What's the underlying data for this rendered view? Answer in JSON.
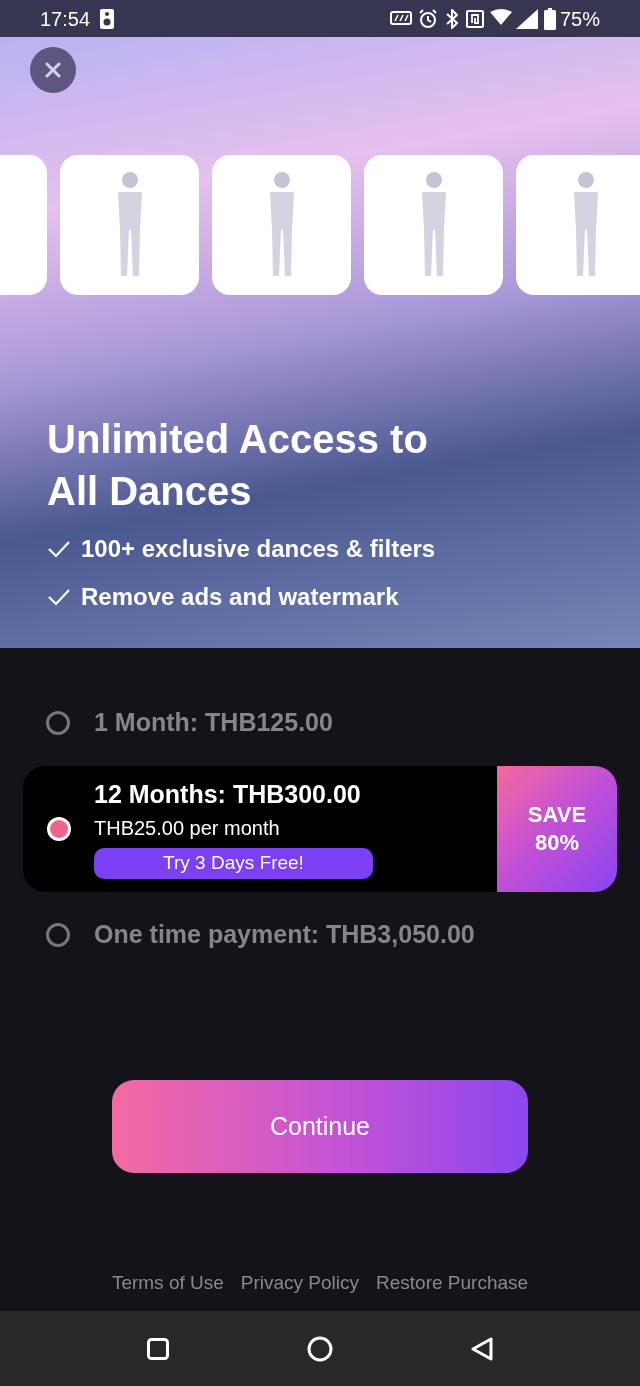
{
  "status_bar": {
    "time": "17:54",
    "battery": "75%"
  },
  "hero": {
    "title": "Unlimited Access to All Dances",
    "features": [
      "100+ exclusive dances & filters",
      "Remove ads and watermark"
    ]
  },
  "plans": [
    {
      "label": "1 Month: THB125.00",
      "selected": false
    },
    {
      "label": "12 Months: THB300.00",
      "selected": true,
      "per_month": "THB25.00 per month",
      "trial": "Try 3 Days Free!",
      "save": "SAVE 80%"
    },
    {
      "label": "One time payment: THB3,050.00",
      "selected": false
    }
  ],
  "continue_button": "Continue",
  "footer_links": [
    "Terms of Use",
    "Privacy Policy",
    "Restore Purchase"
  ]
}
